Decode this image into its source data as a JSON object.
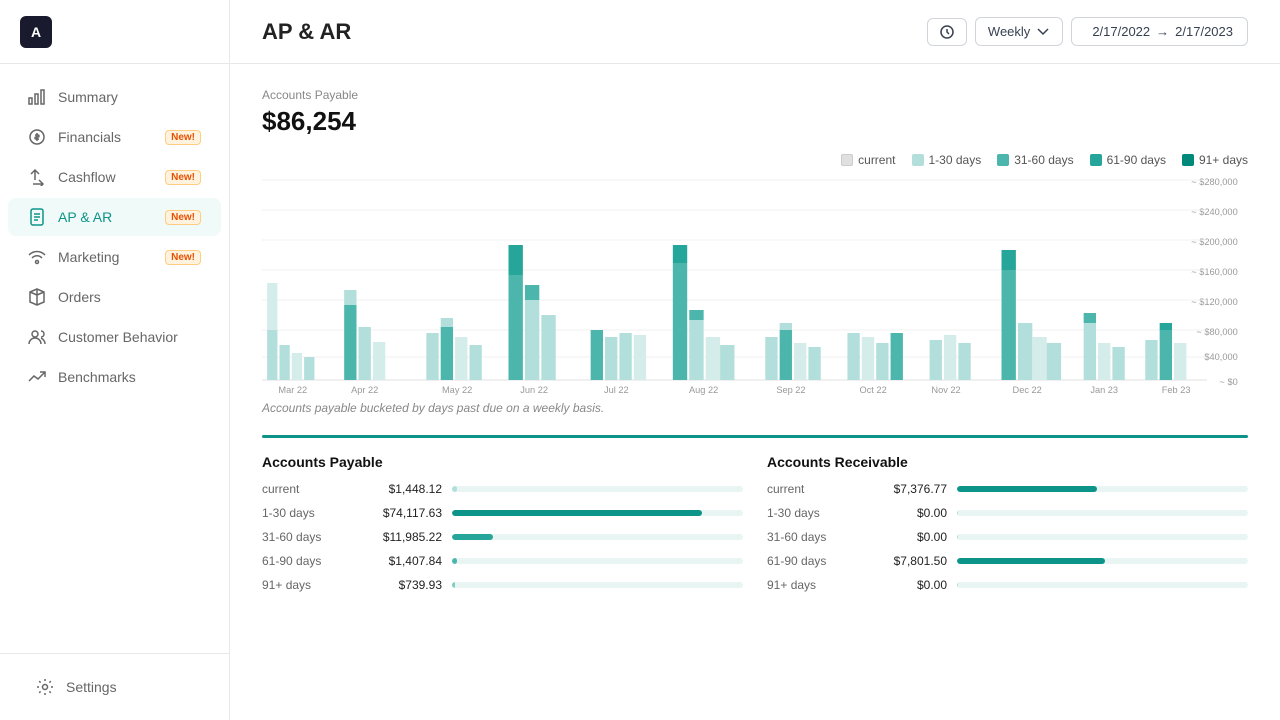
{
  "app": {
    "logo_text": "A",
    "title": "AP & AR"
  },
  "sidebar": {
    "items": [
      {
        "id": "summary",
        "label": "Summary",
        "icon": "chart-bar",
        "active": false,
        "new": false
      },
      {
        "id": "financials",
        "label": "Financials",
        "icon": "dollar-circle",
        "active": false,
        "new": true
      },
      {
        "id": "cashflow",
        "label": "Cashflow",
        "icon": "arrows",
        "active": false,
        "new": true
      },
      {
        "id": "ap-ar",
        "label": "AP & AR",
        "icon": "file-text",
        "active": true,
        "new": true
      },
      {
        "id": "marketing",
        "label": "Marketing",
        "icon": "wifi",
        "active": false,
        "new": true
      },
      {
        "id": "orders",
        "label": "Orders",
        "icon": "box",
        "active": false,
        "new": false
      },
      {
        "id": "customer-behavior",
        "label": "Customer Behavior",
        "icon": "users",
        "active": false,
        "new": false
      },
      {
        "id": "benchmarks",
        "label": "Benchmarks",
        "icon": "trending-up",
        "active": false,
        "new": false
      }
    ],
    "bottom": [
      {
        "id": "settings",
        "label": "Settings",
        "icon": "gear"
      }
    ],
    "new_badge_label": "New!"
  },
  "header": {
    "title": "AP & AR",
    "period_label": "Weekly",
    "date_from": "2/17/2022",
    "date_to": "2/17/2023",
    "arrow": "→"
  },
  "accounts_payable": {
    "label": "Accounts Payable",
    "value": "$86,254"
  },
  "legend": {
    "items": [
      {
        "label": "current",
        "color": "#e8f5f3"
      },
      {
        "label": "1-30 days",
        "color": "#b2dfdb"
      },
      {
        "label": "31-60 days",
        "color": "#4db6ac"
      },
      {
        "label": "61-90 days",
        "color": "#26a69a"
      },
      {
        "label": "91+ days",
        "color": "#00897b"
      }
    ]
  },
  "chart": {
    "y_labels": [
      "$280,000",
      "$240,000",
      "$200,000",
      "$160,000",
      "$120,000",
      "$80,000",
      "$40,000",
      "$0"
    ],
    "x_labels": [
      "Mar 22",
      "Apr 22",
      "May 22",
      "Jun 22",
      "Jul 22",
      "Aug 22",
      "Sep 22",
      "Oct 22",
      "Nov 22",
      "Dec 22",
      "Jan 23",
      "Feb 23"
    ],
    "note": "Accounts payable bucketed by days past due on a weekly basis."
  },
  "ap_table": {
    "title": "Accounts Payable",
    "rows": [
      {
        "label": "current",
        "value": "$1,448.12",
        "pct": 1.7,
        "color": "#b2dfdb"
      },
      {
        "label": "1-30 days",
        "value": "$74,117.63",
        "pct": 86,
        "color": "#0d9488"
      },
      {
        "label": "31-60 days",
        "value": "$11,985.22",
        "pct": 14,
        "color": "#26a69a"
      },
      {
        "label": "61-90 days",
        "value": "$1,407.84",
        "pct": 1.6,
        "color": "#4db6ac"
      },
      {
        "label": "91+ days",
        "value": "$739.93",
        "pct": 0.9,
        "color": "#80cbc4"
      }
    ]
  },
  "ar_table": {
    "title": "Accounts Receivable",
    "rows": [
      {
        "label": "current",
        "value": "$7,376.77",
        "pct": 48,
        "color": "#0d9488"
      },
      {
        "label": "1-30 days",
        "value": "$0.00",
        "pct": 0,
        "color": "#b2dfdb"
      },
      {
        "label": "31-60 days",
        "value": "$0.00",
        "pct": 0,
        "color": "#b2dfdb"
      },
      {
        "label": "61-90 days",
        "value": "$7,801.50",
        "pct": 51,
        "color": "#0d9488"
      },
      {
        "label": "91+ days",
        "value": "$0.00",
        "pct": 0,
        "color": "#b2dfdb"
      }
    ]
  }
}
